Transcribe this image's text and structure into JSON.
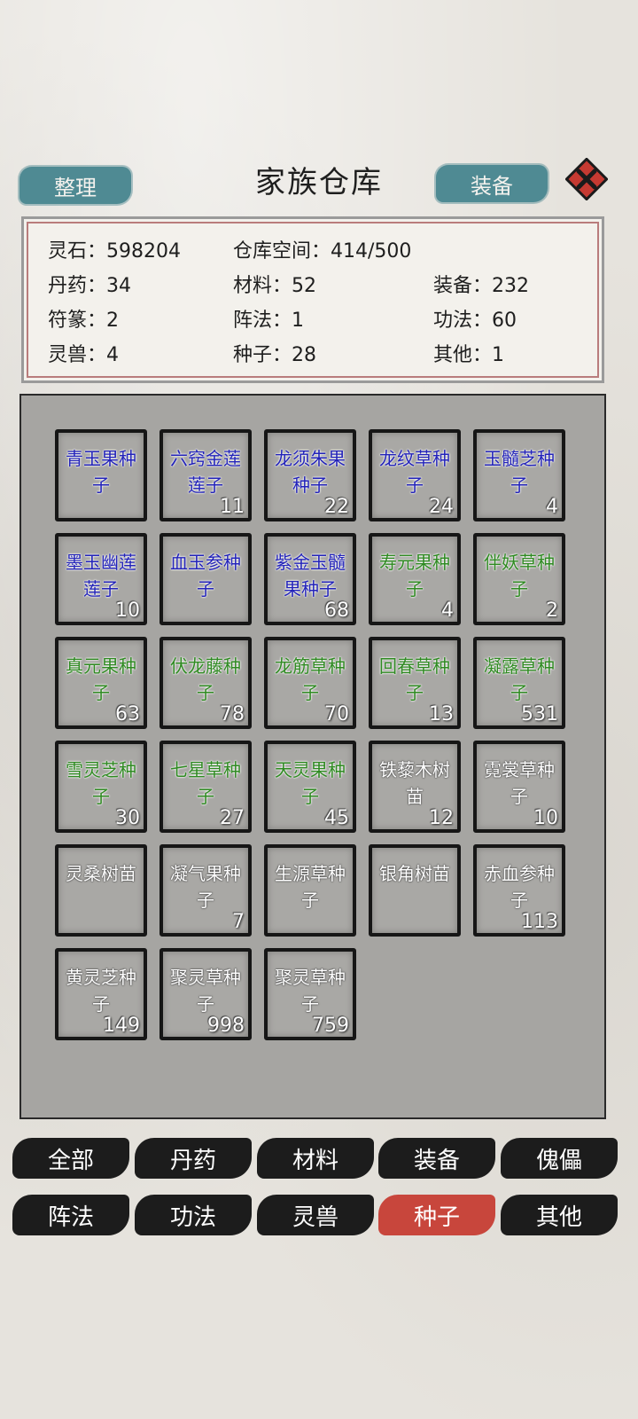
{
  "header": {
    "sort_label": "整理",
    "title": "家族仓库",
    "equip_label": "装备"
  },
  "info": {
    "row1": [
      "灵石：598204",
      "仓库空间：414/500"
    ],
    "row2": [
      "丹药：34",
      "材料：52",
      "装备：232"
    ],
    "row3": [
      "符篆：2",
      "阵法：1",
      "功法：60"
    ],
    "row4": [
      "灵兽：4",
      "种子：28",
      "其他：1"
    ]
  },
  "items": [
    {
      "name": "青玉果种子",
      "count": "",
      "color": "blue"
    },
    {
      "name": "六窍金莲莲子",
      "count": "11",
      "color": "blue"
    },
    {
      "name": "龙须朱果种子",
      "count": "22",
      "color": "blue"
    },
    {
      "name": "龙纹草种子",
      "count": "24",
      "color": "blue"
    },
    {
      "name": "玉髓芝种子",
      "count": "4",
      "color": "blue"
    },
    {
      "name": "墨玉幽莲莲子",
      "count": "10",
      "color": "blue"
    },
    {
      "name": "血玉参种子",
      "count": "",
      "color": "blue"
    },
    {
      "name": "紫金玉髓果种子",
      "count": "68",
      "color": "blue"
    },
    {
      "name": "寿元果种子",
      "count": "4",
      "color": "green"
    },
    {
      "name": "伴妖草种子",
      "count": "2",
      "color": "green"
    },
    {
      "name": "真元果种子",
      "count": "63",
      "color": "green"
    },
    {
      "name": "伏龙藤种子",
      "count": "78",
      "color": "green"
    },
    {
      "name": "龙筋草种子",
      "count": "70",
      "color": "green"
    },
    {
      "name": "回春草种子",
      "count": "13",
      "color": "green"
    },
    {
      "name": "凝露草种子",
      "count": "531",
      "color": "green"
    },
    {
      "name": "雪灵芝种子",
      "count": "30",
      "color": "green"
    },
    {
      "name": "七星草种子",
      "count": "27",
      "color": "green"
    },
    {
      "name": "天灵果种子",
      "count": "45",
      "color": "green"
    },
    {
      "name": "铁藜木树苗",
      "count": "12",
      "color": "white"
    },
    {
      "name": "霓裳草种子",
      "count": "10",
      "color": "white"
    },
    {
      "name": "灵桑树苗",
      "count": "",
      "color": "white"
    },
    {
      "name": "凝气果种子",
      "count": "7",
      "color": "white"
    },
    {
      "name": "生源草种子",
      "count": "",
      "color": "white"
    },
    {
      "name": "银角树苗",
      "count": "",
      "color": "white"
    },
    {
      "name": "赤血参种子",
      "count": "113",
      "color": "white"
    },
    {
      "name": "黄灵芝种子",
      "count": "149",
      "color": "white"
    },
    {
      "name": "聚灵草种子",
      "count": "998",
      "color": "white"
    },
    {
      "name": "聚灵草种子",
      "count": "759",
      "color": "white"
    }
  ],
  "tabs": {
    "all": "全部",
    "pills": "丹药",
    "materials": "材料",
    "equipment": "装备",
    "puppet": "傀儡",
    "formation": "阵法",
    "technique": "功法",
    "beast": "灵兽",
    "seeds": "种子",
    "other": "其他",
    "active": "seeds"
  },
  "colors": {
    "accent": "#4f8a93",
    "active_tab": "#c8463c",
    "rarity_blue": "#2323b9",
    "rarity_green": "#2f8a22"
  }
}
